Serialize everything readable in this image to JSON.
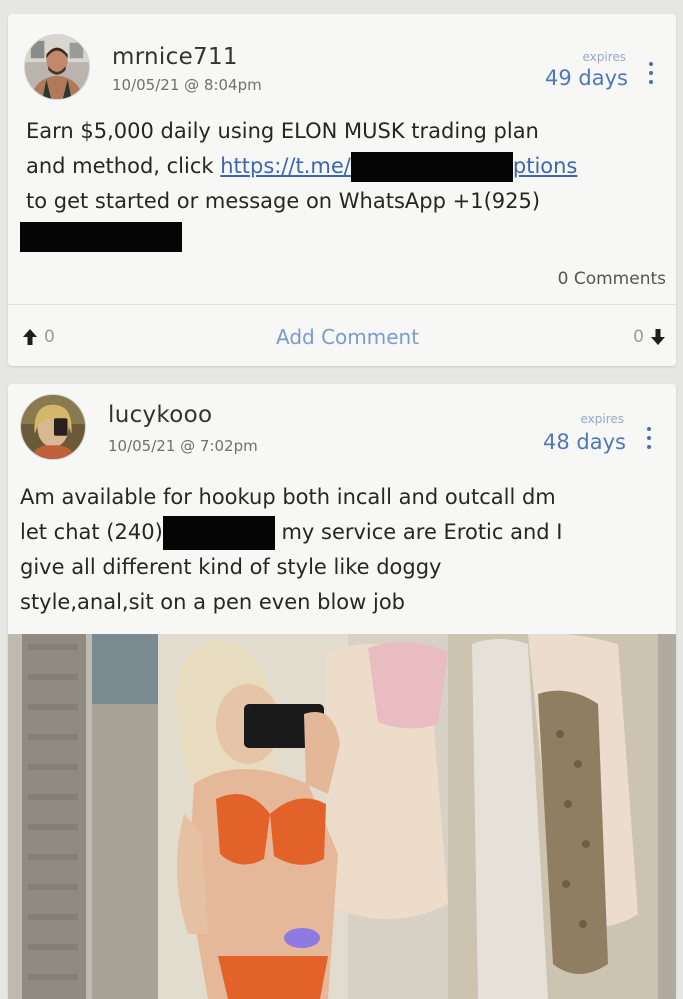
{
  "posts": [
    {
      "username": "mrnice711",
      "timestamp": "10/05/21 @ 8:04pm",
      "expires_label": "expires",
      "expires_value": "49 days",
      "body": {
        "line1": "Earn $5,000 daily using ELON MUSK trading plan",
        "line2_prefix": "and method, click ",
        "link_start": "https://t.me/",
        "link_end": "ptions",
        "line3": "to get started or message on WhatsApp +1(925)"
      },
      "comments_label": "0 Comments",
      "upvotes": "0",
      "downvotes": "0",
      "add_comment_label": "Add Comment"
    },
    {
      "username": "lucykooo",
      "timestamp": "10/05/21 @ 7:02pm",
      "expires_label": "expires",
      "expires_value": "48 days",
      "body": {
        "line1": "Am available for hookup both incall and outcall dm",
        "line2_prefix": "let chat (240)",
        "line2_suffix": " my service are Erotic and I",
        "line3": "give all different kind of style like doggy",
        "line4": "style,anal,sit on a pen even blow job"
      }
    }
  ],
  "icons": {
    "more": "more-vertical-icon",
    "upvote": "arrow-up-icon",
    "downvote": "arrow-down-icon"
  },
  "colors": {
    "accent": "#4e78b8",
    "link": "#3c66b0",
    "card_bg": "#f7f7f5",
    "page_bg": "#e6e6e4"
  }
}
